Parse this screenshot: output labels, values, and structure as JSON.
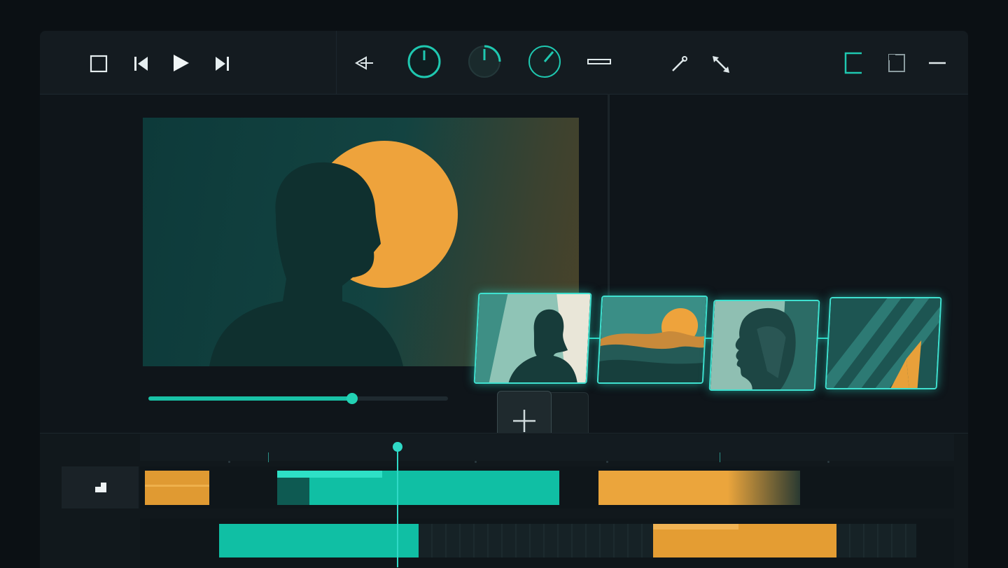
{
  "toolbar": {
    "transport": [
      {
        "icon": "stop-icon"
      },
      {
        "icon": "skip-back-icon"
      },
      {
        "icon": "play-icon"
      },
      {
        "icon": "skip-forward-icon"
      }
    ],
    "tools": [
      {
        "icon": "audio-pan-icon"
      },
      {
        "icon": "volume-knob-icon",
        "level": 1.0
      },
      {
        "icon": "gain-knob-icon",
        "level": 0.25
      },
      {
        "icon": "pan-knob-icon",
        "level": 0.12
      },
      {
        "icon": "trim-icon"
      },
      {
        "icon": "razor-icon"
      },
      {
        "icon": "move-arrows-icon"
      }
    ],
    "window": [
      {
        "icon": "panel-left-icon"
      },
      {
        "icon": "restore-icon"
      },
      {
        "icon": "minimize-icon"
      }
    ]
  },
  "viewer": {
    "scrub_progress": 0.68
  },
  "media_strip": {
    "thumbnails": [
      {
        "icon": "portrait-woman-thumbnail"
      },
      {
        "icon": "desert-sunset-thumbnail"
      },
      {
        "icon": "face-profile-thumbnail"
      },
      {
        "icon": "abstract-stripes-thumbnail"
      }
    ],
    "add_icon": "plus-icon"
  },
  "timeline": {
    "track_head_icon": "track-type-icon",
    "playhead_icon": "playhead-icon",
    "colors": {
      "accent": "#19c2a6",
      "orange": "#e8a03a",
      "panel": "#0f151a"
    }
  }
}
